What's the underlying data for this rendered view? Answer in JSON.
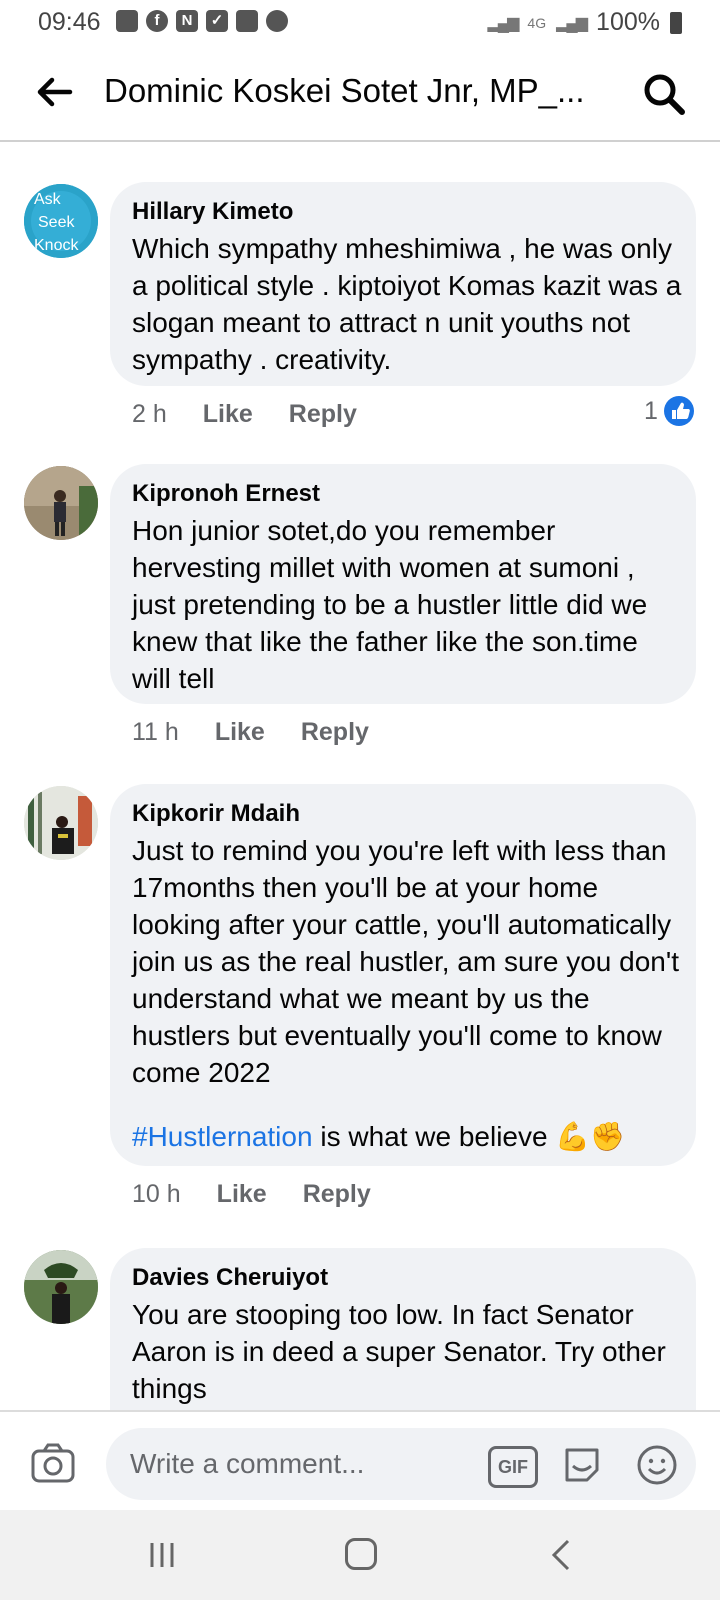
{
  "status": {
    "time": "09:46",
    "network": "4G",
    "battery": "100%"
  },
  "header": {
    "title": "Dominic Koskei Sotet Jnr, MP_..."
  },
  "comments": [
    {
      "author": "Hillary Kimeto",
      "avatar_text": [
        "Ask",
        "Seek",
        "Knock"
      ],
      "text": "Which sympathy mheshimiwa , he was only a political style . kiptoiyot Komas kazit was a slogan meant to attract  n unit youths not sympathy . creativity.",
      "time": "2 h",
      "like_label": "Like",
      "reply_label": "Reply",
      "reaction_count": "1"
    },
    {
      "author": "Kipronoh Ernest",
      "text": "Hon junior sotet,do you remember hervesting millet with women at sumoni , just pretending to be  a hustler little did we knew that like the  father  like the son.time will tell",
      "time": "11 h",
      "like_label": "Like",
      "reply_label": "Reply"
    },
    {
      "author": "Kipkorir Mdaih",
      "text": "Just to remind you you're left with less than 17months then you'll be at your home looking after your cattle, you'll automatically join us as the real hustler, am sure you don't understand what we meant by us the hustlers but eventually you'll come to know come 2022",
      "hashtag": "#Hustlernation",
      "hashtag_tail": " is what we believe 💪✊",
      "time": "10 h",
      "like_label": "Like",
      "reply_label": "Reply"
    },
    {
      "author": "Davies Cheruiyot",
      "text": "You are stooping too low. In fact Senator Aaron is in deed a super Senator. Try other things"
    }
  ],
  "composer": {
    "placeholder": "Write a comment...",
    "gif_label": "GIF"
  }
}
